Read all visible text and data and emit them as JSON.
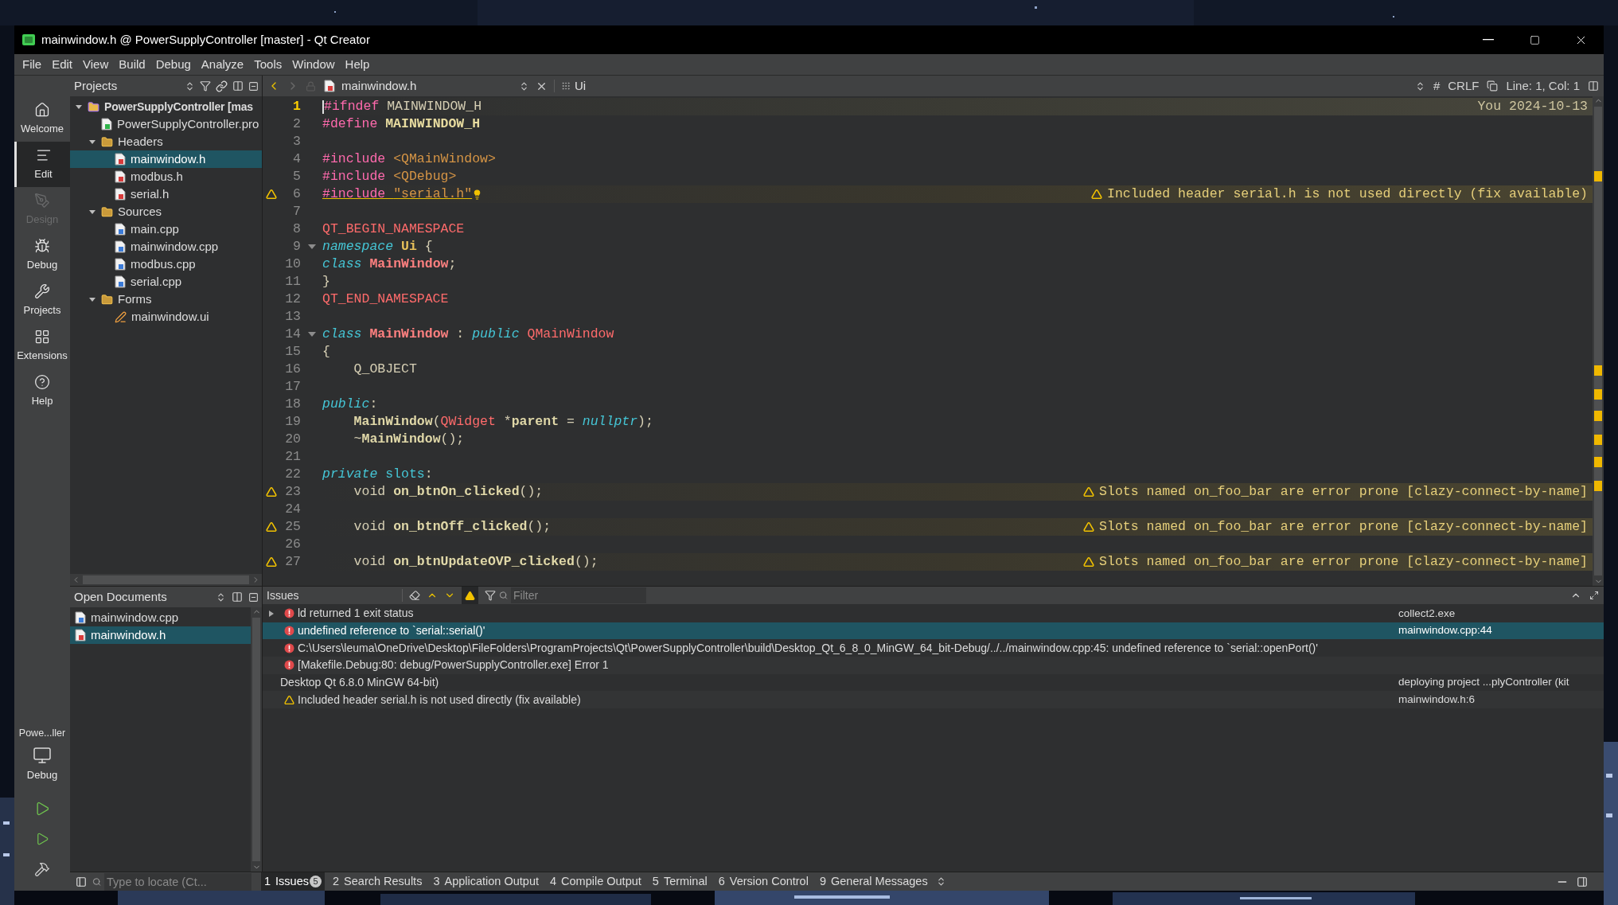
{
  "window": {
    "title": "mainwindow.h @ PowerSupplyController [master] - Qt Creator"
  },
  "menu": [
    "File",
    "Edit",
    "View",
    "Build",
    "Debug",
    "Analyze",
    "Tools",
    "Window",
    "Help"
  ],
  "mode_bar": [
    {
      "label": "Welcome",
      "kind": "welcome",
      "selected": false,
      "disabled": false
    },
    {
      "label": "Edit",
      "kind": "edit",
      "selected": true,
      "disabled": false
    },
    {
      "label": "Design",
      "kind": "design",
      "selected": false,
      "disabled": true
    },
    {
      "label": "Debug",
      "kind": "debug",
      "selected": false,
      "disabled": false
    },
    {
      "label": "Projects",
      "kind": "projects",
      "selected": false,
      "disabled": false
    },
    {
      "label": "Extensions",
      "kind": "extensions",
      "selected": false,
      "disabled": false
    },
    {
      "label": "Help",
      "kind": "help",
      "selected": false,
      "disabled": false
    }
  ],
  "kit": {
    "project": "Powe...ller",
    "config": "Debug"
  },
  "projects_panel": {
    "title": "Projects",
    "tree": [
      {
        "label": "PowerSupplyController [mas",
        "kind": "project",
        "selected": false,
        "expanded": true,
        "children": [
          {
            "label": "PowerSupplyController.pro",
            "kind": "pro",
            "selected": false
          },
          {
            "label": "Headers",
            "kind": "folder",
            "selected": false,
            "expanded": true,
            "children": [
              {
                "label": "mainwindow.h",
                "kind": "header",
                "selected": true
              },
              {
                "label": "modbus.h",
                "kind": "header",
                "selected": false
              },
              {
                "label": "serial.h",
                "kind": "header",
                "selected": false
              }
            ]
          },
          {
            "label": "Sources",
            "kind": "folder",
            "selected": false,
            "expanded": true,
            "children": [
              {
                "label": "main.cpp",
                "kind": "source",
                "selected": false
              },
              {
                "label": "mainwindow.cpp",
                "kind": "source",
                "selected": false
              },
              {
                "label": "modbus.cpp",
                "kind": "source",
                "selected": false
              },
              {
                "label": "serial.cpp",
                "kind": "source",
                "selected": false
              }
            ]
          },
          {
            "label": "Forms",
            "kind": "formfolder",
            "selected": false,
            "expanded": true,
            "children": [
              {
                "label": "mainwindow.ui",
                "kind": "form",
                "selected": false
              }
            ]
          }
        ]
      }
    ]
  },
  "open_documents": {
    "title": "Open Documents",
    "items": [
      {
        "label": "mainwindow.cpp",
        "kind": "source",
        "selected": false
      },
      {
        "label": "mainwindow.h",
        "kind": "header",
        "selected": true
      }
    ]
  },
  "editor": {
    "file": "mainwindow.h",
    "symbol": "Ui",
    "hash": "#",
    "line_ending": "CRLF",
    "position": "Line: 1, Col: 1",
    "lines": [
      {
        "number": "1",
        "current": true,
        "blame": "You 2024-10-13",
        "tokens": [
          {
            "t": "#ifndef ",
            "kind": "pp"
          },
          {
            "t": "MAINWINDOW_H",
            "kind": "plain"
          }
        ]
      },
      {
        "number": "2",
        "current": false,
        "tokens": [
          {
            "t": "#define ",
            "kind": "pp"
          },
          {
            "t": "MAINWINDOW_H",
            "kind": "ppname"
          }
        ]
      },
      {
        "number": "3",
        "current": false
      },
      {
        "number": "4",
        "current": false,
        "tokens": [
          {
            "t": "#include ",
            "kind": "pp"
          },
          {
            "t": "<QMainWindow>",
            "kind": "str"
          }
        ]
      },
      {
        "number": "5",
        "current": false,
        "tokens": [
          {
            "t": "#include ",
            "kind": "pp"
          },
          {
            "t": "<QDebug>",
            "kind": "str"
          }
        ]
      },
      {
        "number": "6",
        "current": false,
        "warning": "Included header serial.h is not used directly (fix available)",
        "hint": true,
        "tokens": [
          {
            "t": "#include ",
            "kind": "pp",
            "underlined": true
          },
          {
            "t": "\"serial.h\"",
            "kind": "str",
            "underlined": true
          }
        ]
      },
      {
        "number": "7",
        "current": false
      },
      {
        "number": "8",
        "current": false,
        "tokens": [
          {
            "t": "QT_BEGIN_NAMESPACE",
            "kind": "macro"
          }
        ]
      },
      {
        "number": "9",
        "current": false,
        "fold": true,
        "tokens": [
          {
            "t": "namespace ",
            "kind": "kw"
          },
          {
            "t": "Ui",
            "kind": "ns"
          },
          {
            "t": " {",
            "kind": "plain"
          }
        ]
      },
      {
        "number": "10",
        "current": false,
        "tokens": [
          {
            "t": "class ",
            "kind": "kw"
          },
          {
            "t": "MainWindow",
            "kind": "type"
          },
          {
            "t": ";",
            "kind": "plain"
          }
        ]
      },
      {
        "number": "11",
        "current": false,
        "tokens": [
          {
            "t": "}",
            "kind": "plain"
          }
        ]
      },
      {
        "number": "12",
        "current": false,
        "tokens": [
          {
            "t": "QT_END_NAMESPACE",
            "kind": "macro"
          }
        ]
      },
      {
        "number": "13",
        "current": false
      },
      {
        "number": "14",
        "current": false,
        "fold": true,
        "tokens": [
          {
            "t": "class ",
            "kind": "kw"
          },
          {
            "t": "MainWindow",
            "kind": "type"
          },
          {
            "t": " : ",
            "kind": "plain"
          },
          {
            "t": "public ",
            "kind": "kw"
          },
          {
            "t": "QMainWindow",
            "kind": "macro"
          }
        ]
      },
      {
        "number": "15",
        "current": false,
        "tokens": [
          {
            "t": "{",
            "kind": "plain"
          }
        ]
      },
      {
        "number": "16",
        "current": false,
        "tokens": [
          {
            "t": "    Q_OBJECT",
            "kind": "plain"
          }
        ]
      },
      {
        "number": "17",
        "current": false
      },
      {
        "number": "18",
        "current": false,
        "tokens": [
          {
            "t": "public",
            "kind": "kw"
          },
          {
            "t": ":",
            "kind": "plain"
          }
        ]
      },
      {
        "number": "19",
        "current": false,
        "tokens": [
          {
            "t": "    MainWindow",
            "kind": "fn"
          },
          {
            "t": "(",
            "kind": "plain"
          },
          {
            "t": "QWidget",
            "kind": "macro"
          },
          {
            "t": " *",
            "kind": "plain"
          },
          {
            "t": "parent",
            "kind": "fn"
          },
          {
            "t": " = ",
            "kind": "plain"
          },
          {
            "t": "nullptr",
            "kind": "kw"
          },
          {
            "t": ");",
            "kind": "plain"
          }
        ]
      },
      {
        "number": "20",
        "current": false,
        "tokens": [
          {
            "t": "    ~",
            "kind": "plain"
          },
          {
            "t": "MainWindow",
            "kind": "fn"
          },
          {
            "t": "();",
            "kind": "plain"
          }
        ]
      },
      {
        "number": "21",
        "current": false
      },
      {
        "number": "22",
        "current": false,
        "tokens": [
          {
            "t": "private ",
            "kind": "kw"
          },
          {
            "t": "slots",
            "kind": "kw2"
          },
          {
            "t": ":",
            "kind": "plain"
          }
        ]
      },
      {
        "number": "23",
        "current": false,
        "warning": "Slots named on_foo_bar are error prone [clazy-connect-by-name]",
        "tokens": [
          {
            "t": "    void ",
            "kind": "plain"
          },
          {
            "t": "on_btnOn_clicked",
            "kind": "fn"
          },
          {
            "t": "();",
            "kind": "plain"
          }
        ]
      },
      {
        "number": "24",
        "current": false
      },
      {
        "number": "25",
        "current": false,
        "warning": "Slots named on_foo_bar are error prone [clazy-connect-by-name]",
        "tokens": [
          {
            "t": "    void ",
            "kind": "plain"
          },
          {
            "t": "on_btnOff_clicked",
            "kind": "fn"
          },
          {
            "t": "();",
            "kind": "plain"
          }
        ]
      },
      {
        "number": "26",
        "current": false
      },
      {
        "number": "27",
        "current": false,
        "warning": "Slots named on_foo_bar are error prone [clazy-connect-by-name]",
        "tokens": [
          {
            "t": "    void ",
            "kind": "plain"
          },
          {
            "t": "on_btnUpdateOVP_clicked",
            "kind": "fn"
          },
          {
            "t": "();",
            "kind": "plain"
          }
        ]
      }
    ]
  },
  "issues": {
    "title": "Issues",
    "filter_placeholder": "Filter",
    "rows": [
      {
        "kind": "error",
        "text": "ld returned 1 exit status",
        "location": "collect2.exe",
        "selected": false,
        "expanded": false
      },
      {
        "kind": "error",
        "text": "undefined reference to `serial::serial()'",
        "location": "mainwindow.cpp:44",
        "selected": true
      },
      {
        "kind": "error",
        "text": "C:\\Users\\leuma\\OneDrive\\Desktop\\FileFolders\\ProgramProjects\\Qt\\PowerSupplyController\\build\\Desktop_Qt_6_8_0_MinGW_64_bit-Debug/../../mainwindow.cpp:45: undefined reference to `serial::openPort()'",
        "selected": false
      },
      {
        "kind": "error",
        "text": "[Makefile.Debug:80: debug/PowerSupplyController.exe] Error 1",
        "selected": false
      },
      {
        "kind": "info",
        "text": "Desktop Qt 6.8.0 MinGW 64-bit)",
        "location": "deploying project ...plyController (kit",
        "selected": false
      },
      {
        "kind": "warning",
        "text": "Included header serial.h is not used directly (fix available)",
        "location": "mainwindow.h:6",
        "selected": false
      }
    ]
  },
  "bottom_bar": {
    "locator_placeholder": "Type to locate (Ct...",
    "tabs": [
      {
        "number": "1",
        "label": "Issues",
        "badge": "5",
        "selected": true
      },
      {
        "number": "2",
        "label": "Search Results",
        "selected": false
      },
      {
        "number": "3",
        "label": "Application Output",
        "selected": false
      },
      {
        "number": "4",
        "label": "Compile Output",
        "selected": false
      },
      {
        "number": "5",
        "label": "Terminal",
        "selected": false
      },
      {
        "number": "6",
        "label": "Version Control",
        "selected": false
      },
      {
        "number": "9",
        "label": "General Messages",
        "selected": false
      }
    ]
  }
}
